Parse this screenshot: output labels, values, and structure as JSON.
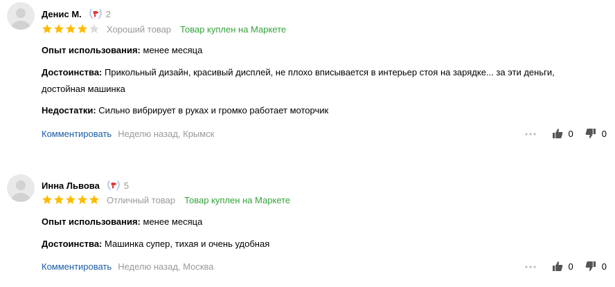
{
  "reviews": [
    {
      "author": "Денис М.",
      "badge_count": "2",
      "rating": 4,
      "rating_max": 5,
      "rating_text": "Хороший товар",
      "verified": "Товар куплен на Маркете",
      "usage_label": "Опыт использования:",
      "usage_value": "менее месяца",
      "pros_label": "Достоинства:",
      "pros_value": "Прикольный дизайн, красивый дисплей, не плохо вписывается в интерьер стоя на зарядке... за эти деньги, достойная машинка",
      "cons_label": "Недостатки:",
      "cons_value": "Сильно вибрирует в руках и громко работает моторчик",
      "comment_label": "Комментировать",
      "meta": "Неделю назад, Крымск",
      "likes": "0",
      "dislikes": "0"
    },
    {
      "author": "Инна Львова",
      "badge_count": "5",
      "rating": 5,
      "rating_max": 5,
      "rating_text": "Отличный товар",
      "verified": "Товар куплен на Маркете",
      "usage_label": "Опыт использования:",
      "usage_value": "менее месяца",
      "pros_label": "Достоинства:",
      "pros_value": "Машинка супер, тихая и очень удобная",
      "comment_label": "Комментировать",
      "meta": "Неделю назад, Москва",
      "likes": "0",
      "dislikes": "0"
    }
  ],
  "icons": {
    "avatar": "user-silhouette-icon",
    "badge": "laurel-hairdryer-badge-icon",
    "star": "star-icon",
    "more": "more-dots-icon",
    "like": "thumbs-up-icon",
    "dislike": "thumbs-down-icon"
  },
  "colors": {
    "star_filled": "#fdbc00",
    "star_empty": "#dcdcdc",
    "verified": "#33a33a",
    "link": "#1a5ba6",
    "muted": "#999999",
    "badge_red": "#e53935",
    "badge_laurel": "#b9c8f0"
  }
}
